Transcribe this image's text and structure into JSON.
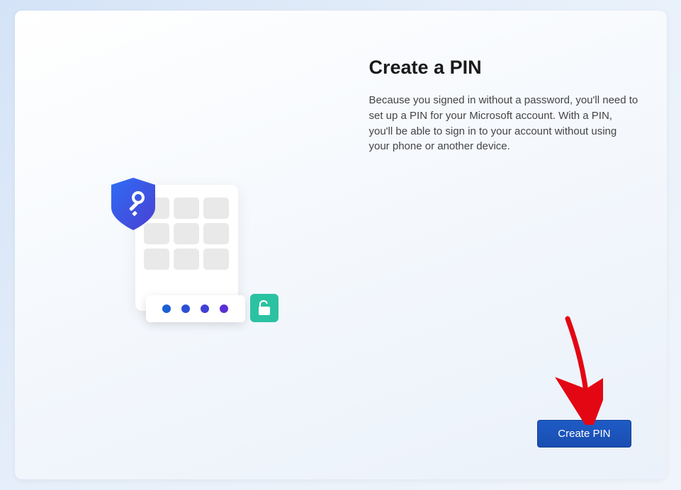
{
  "dialog": {
    "title": "Create a PIN",
    "description": "Because you signed in without a password, you'll need to set up a PIN for your Microsoft account. With a PIN, you'll be able to sign in to your account without using your phone or another device.",
    "primary_button_label": "Create PIN"
  },
  "illustration": {
    "shield_icon": "shield-key",
    "lock_icon": "unlock",
    "pin_dots": 4,
    "keypad_keys": 9
  },
  "colors": {
    "primary_button": "#1a4eb0",
    "lock_badge": "#2bc2a2",
    "shield_start": "#2e6df6",
    "shield_end": "#4b3fd1"
  }
}
